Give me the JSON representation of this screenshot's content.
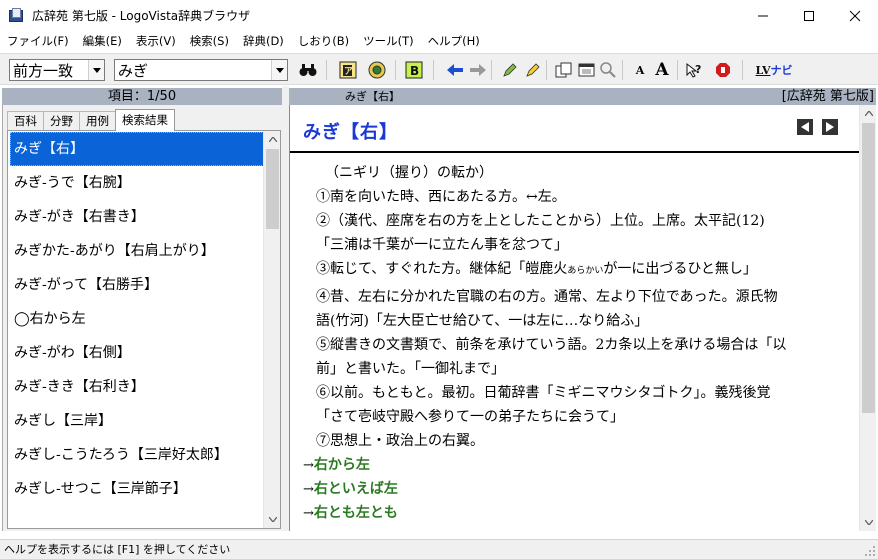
{
  "window": {
    "title": "広辞苑 第七版 - LogoVista辞典ブラウザ",
    "minimize": "—",
    "maximize": "☐",
    "close": "✕"
  },
  "menu": [
    "ファイル(F)",
    "編集(E)",
    "表示(V)",
    "検索(S)",
    "辞典(D)",
    "しおり(B)",
    "ツール(T)",
    "ヘルプ(H)"
  ],
  "toolbar": {
    "search_mode": "前方一致",
    "search_text": "みぎ",
    "font_small_label": "A",
    "font_large_label": "A",
    "nav_label": "ナビ",
    "lv_label": "LV",
    "b_label": "B"
  },
  "left_panel": {
    "header": "項目：1/50",
    "tabs": [
      "百科",
      "分野",
      "用例",
      "検索結果"
    ],
    "active_tab": 3,
    "items": [
      "みぎ【右】",
      "みぎ‐うで【右腕】",
      "みぎ‐がき【右書き】",
      "みぎかた‐あがり【右肩上がり】",
      "みぎ‐がって【右勝手】",
      "◯右から左",
      "みぎ‐がわ【右側】",
      "みぎ‐きき【右利き】",
      "みぎし【三岸】",
      "みぎし‐こうたろう【三岸好太郎】",
      "みぎし‐せつこ【三岸節子】"
    ],
    "selected_index": 0
  },
  "right_panel": {
    "header_headword": "みぎ【右】",
    "header_dict": "[広辞苑 第七版]",
    "entry_title": "みぎ【右】",
    "lines": [
      "（ニギリ（握り）の転か）",
      "①南を向いた時、西にあたる方。↔左。",
      "②（漢代、座席を右の方を上としたことから）上位。上席。太平記(12)",
      "「三浦は千葉が一に立たん事を忿つて」",
      "③転じて、すぐれた方。継体紀「皚鹿火",
      "④昔、左右に分かれた官職の右の方。通常、左より下位であった。源氏物",
      "語(竹河)「左大臣亡せ給ひて、一は左に…なり給ふ」",
      "⑤縦書きの文書類で、前条を承けていう語。2カ条以上を承ける場合は「以",
      "前」と書いた。「一御礼まで」",
      "⑥以前。もともと。最初。日葡辞書「ミギニマウシタゴトク」。義残後覚",
      "「さて壱岐守殿へ参りて一の弟子たちに会うて」",
      "⑦思想上・政治上の右翼。"
    ],
    "ruby_text": "あらかい",
    "line5_tail": "が一に出づるひと無し」",
    "links": [
      "右から左",
      "右といえば左",
      "右とも左とも"
    ],
    "link_arrow": "→"
  },
  "status": {
    "text": "ヘルプを表示するには [F1] を押してください"
  }
}
